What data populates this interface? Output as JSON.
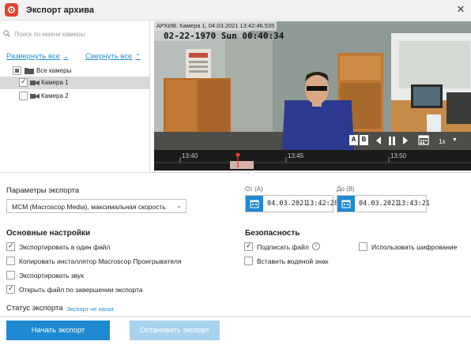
{
  "window": {
    "title": "Экспорт архива",
    "close_icon": "close-icon"
  },
  "camera_list": {
    "search_placeholder": "Поиск по имени камеры",
    "expand_all": "Развернуть все",
    "collapse_all": "Свернуть все",
    "root_label": "Все камеры",
    "cameras": [
      {
        "label": "Камера 1",
        "checked": true,
        "selected": true
      },
      {
        "label": "Камера 2",
        "checked": false,
        "selected": false
      }
    ]
  },
  "video": {
    "overlay_caption": "АРХИВ: Камера 1, 04.03.2021 13:42:46.535",
    "osd_timestamp": "02-22-1970 Sun 00:40:34",
    "speed": "1x",
    "marker_a": "A",
    "marker_b": "B",
    "timeline_ticks": [
      "13:40",
      "13:45",
      "13:50"
    ]
  },
  "params": {
    "section_label": "Параметры экспорта",
    "format_selected": "MCM (Macroscop Media), максимальная скорость"
  },
  "range": {
    "from_label": "От (А)",
    "to_label": "До (В)",
    "from_date": "04.03.2021",
    "from_time": "13:42:28",
    "to_date": "04.03.2021",
    "to_time": "13:43:21"
  },
  "main_settings": {
    "title": "Основные настройки",
    "export_single_file": "Экспортировать в один файл",
    "copy_player_installer": "Копировать инсталлятор Macroscop Проигрывателя",
    "export_sound": "Экспортировать звук",
    "open_after_export": "Открыть файл по завершении экспорта"
  },
  "security": {
    "title": "Безопасность",
    "sign_file": "Подписать файл",
    "use_encryption": "Использовать шифрование",
    "insert_watermark": "Вставить водяной знак"
  },
  "status": {
    "label": "Статус экспорта",
    "value": "Экспорт не начат."
  },
  "actions": {
    "start": "Начать экспорт",
    "stop": "Остановить экспорт"
  },
  "colors": {
    "accent": "#1f8ad1",
    "link": "#1e8fd6",
    "brand": "#e8432e",
    "disabled_button": "#a9d2ee"
  }
}
